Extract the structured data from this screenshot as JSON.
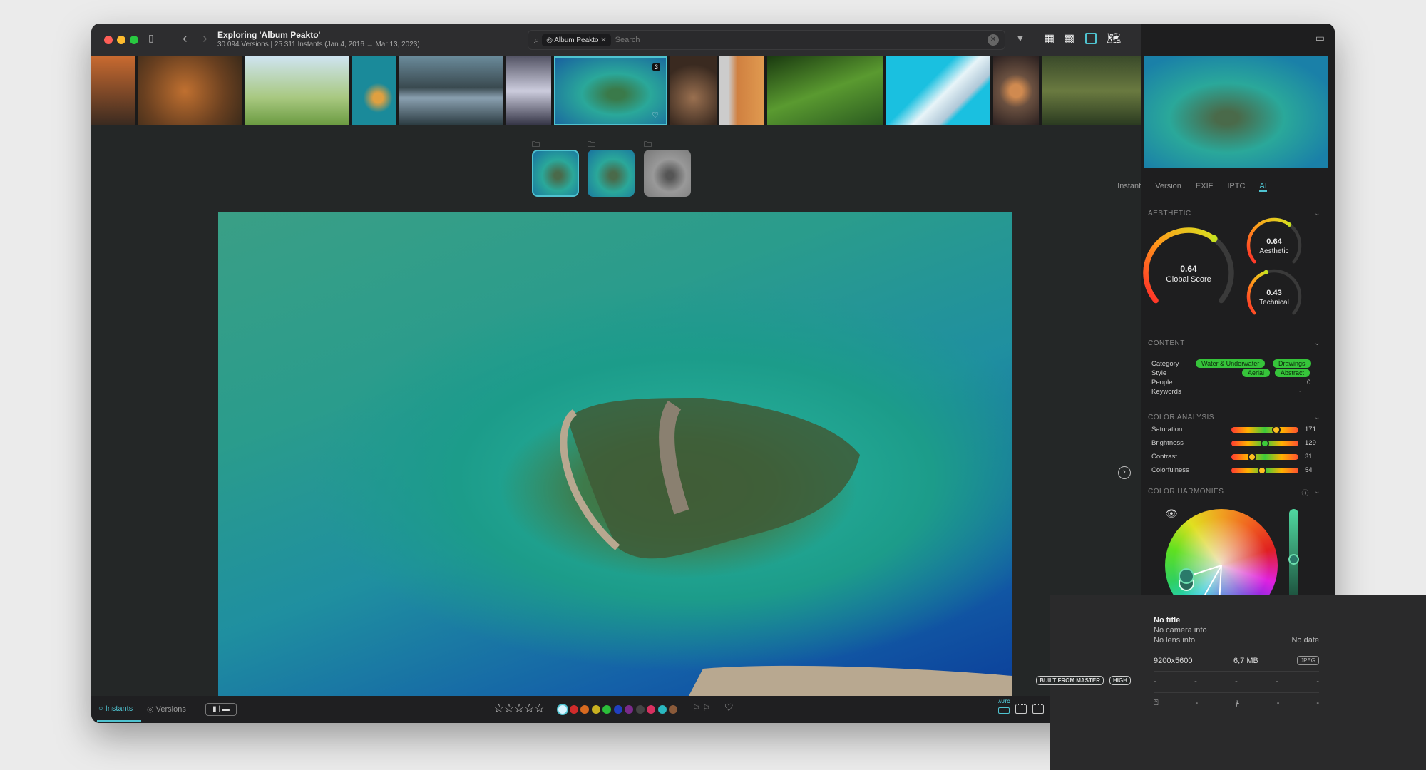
{
  "window": {
    "title": "Exploring 'Album Peakto'",
    "subtitle": "30 094 Versions | 25 311 Instants (Jan 4, 2016 → Mar 13, 2023)"
  },
  "search": {
    "chip": "Album Peakto",
    "placeholder": "Search"
  },
  "toolbar": {
    "icons": [
      "sidebar-toggle-icon",
      "back-icon",
      "forward-icon",
      "filter-icon",
      "grid-small-icon",
      "grid-large-icon",
      "single-view-icon",
      "map-icon",
      "inspector-toggle-icon"
    ]
  },
  "filmstrip": {
    "selected_badge": "3"
  },
  "badges": {
    "built": "BUILT FROM MASTER",
    "quality": "HIGH"
  },
  "bottom": {
    "instants": "Instants",
    "versions": "Versions",
    "auto": "AUTO",
    "rating": 0,
    "colors": [
      "#d8f4ff",
      "#d02b2b",
      "#d86a20",
      "#c8b020",
      "#2bbf3a",
      "#2040c0",
      "#7a2a8a",
      "#444",
      "#d83060",
      "#2ab8c0",
      "#8a5a3a"
    ]
  },
  "inspector": {
    "tabs": [
      "Instant",
      "Version",
      "EXIF",
      "IPTC",
      "AI"
    ],
    "active_tab": "AI",
    "aesthetic": {
      "header": "AESTHETIC",
      "gauges": [
        {
          "value": "0.64",
          "label": "Global Score",
          "fraction": 0.64
        },
        {
          "value": "0.64",
          "label": "Aesthetic",
          "fraction": 0.64
        },
        {
          "value": "0.43",
          "label": "Technical",
          "fraction": 0.43
        }
      ]
    },
    "content": {
      "header": "CONTENT",
      "category_label": "Category",
      "category": [
        "Water & Underwater",
        "Drawings"
      ],
      "style_label": "Style",
      "style": [
        "Aerial",
        "Abstract"
      ],
      "people_label": "People",
      "people": "0",
      "keywords_label": "Keywords",
      "keywords": "-"
    },
    "color_analysis": {
      "header": "COLOR ANALYSIS",
      "rows": [
        {
          "label": "Saturation",
          "value": "171",
          "position": 0.67
        },
        {
          "label": "Brightness",
          "value": "129",
          "position": 0.5
        },
        {
          "label": "Contrast",
          "value": "31",
          "position": 0.31
        },
        {
          "label": "Colorfulness",
          "value": "54",
          "position": 0.46
        }
      ]
    },
    "color_harmonies": {
      "header": "COLOR HARMONIES",
      "slider_position": 0.5
    },
    "info": {
      "title": "No title",
      "camera": "No camera info",
      "lens": "No lens info",
      "date": "No date",
      "dimensions": "9200x5600",
      "size": "6,7 MB",
      "format": "JPEG",
      "dash": "-"
    }
  },
  "colors": {
    "accent": "#4fc3d0",
    "pill": "#36c43a"
  }
}
